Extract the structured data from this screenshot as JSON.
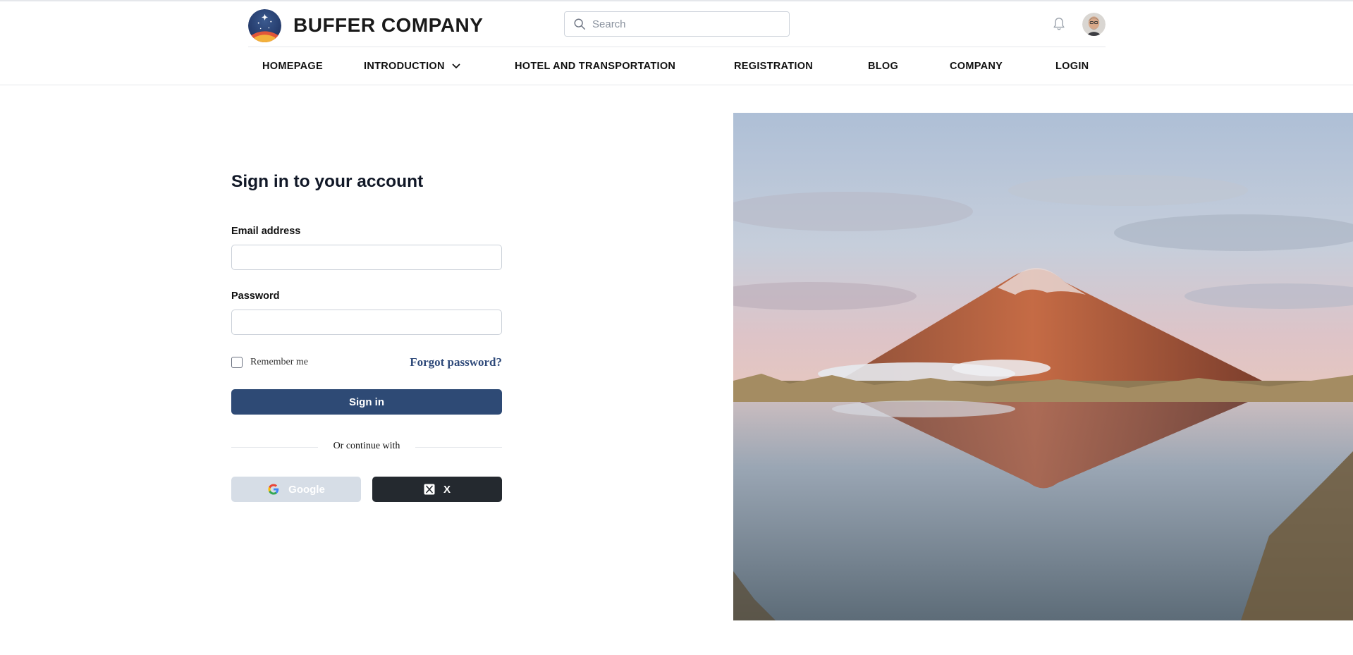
{
  "header": {
    "brand_name": "BUFFER COMPANY",
    "search_placeholder": "Search",
    "nav": [
      {
        "label": "HOMEPAGE"
      },
      {
        "label": "INTRODUCTION",
        "has_dropdown": true
      },
      {
        "label": "HOTEL AND TRANSPORTATION"
      },
      {
        "label": "REGISTRATION"
      },
      {
        "label": "BLOG"
      },
      {
        "label": "COMPANY"
      },
      {
        "label": "LOGIN"
      }
    ],
    "icons": [
      "logo",
      "search-icon",
      "bell-icon",
      "avatar",
      "chevron-down-icon"
    ]
  },
  "signin": {
    "title": "Sign in to your account",
    "email_label": "Email address",
    "email_value": "",
    "password_label": "Password",
    "password_value": "",
    "remember_label": "Remember me",
    "remember_checked": false,
    "forgot_label": "Forgot password?",
    "submit_label": "Sign in",
    "divider_label": "Or continue with",
    "google_label": "Google",
    "x_label": "X"
  },
  "colors": {
    "primary": "#2e4a75",
    "link": "#2f4a7a",
    "google_button_bg": "#d6dde6",
    "x_button_bg": "#24292f"
  },
  "hero": {
    "image": "mountain reflected in lake at sunset"
  }
}
